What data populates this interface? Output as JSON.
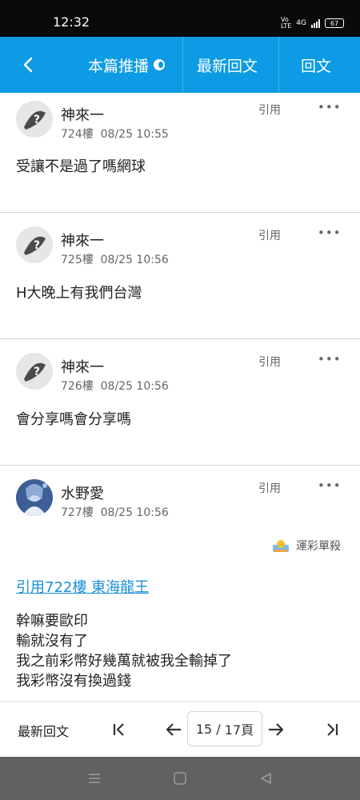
{
  "status_bar": {
    "time": "12:32",
    "network": "4G",
    "battery": "67"
  },
  "nav": {
    "back_icon": "chevron-left-icon",
    "tab_broadcast": "本篇推播",
    "tab_latest": "最新回文",
    "tab_reply": "回文"
  },
  "posts": [
    {
      "author": "神來一",
      "floor": "724樓",
      "time": "08/25 10:55",
      "quote": "引用",
      "more": "•••",
      "body": "受讓不是過了嗎網球"
    },
    {
      "author": "神來一",
      "floor": "725樓",
      "time": "08/25 10:56",
      "quote": "引用",
      "more": "•••",
      "body": "H大晚上有我們台灣"
    },
    {
      "author": "神來一",
      "floor": "726樓",
      "time": "08/25 10:56",
      "quote": "引用",
      "more": "•••",
      "body": "會分享嗎會分享嗎"
    },
    {
      "author": "水野愛",
      "floor": "727樓",
      "time": "08/25 10:56",
      "quote": "引用",
      "more": "•••",
      "tag": "運彩單殺",
      "quote_link": "引用722樓 東海龍王",
      "lines": [
        "幹嘛要歐印",
        "輸就沒有了",
        "我之前彩幣好幾萬就被我全輸掉了",
        "我彩幣沒有換過錢"
      ]
    }
  ],
  "bottom_bar": {
    "latest_label": "最新回文",
    "page_current": "15",
    "page_sep": " / ",
    "page_total": "17頁",
    "first_icon": "first-page-icon",
    "prev_icon": "arrow-left-icon",
    "next_icon": "arrow-right-icon",
    "last_icon": "last-page-icon"
  },
  "colors": {
    "accent": "#0c9be4",
    "link": "#1b8fd7"
  }
}
